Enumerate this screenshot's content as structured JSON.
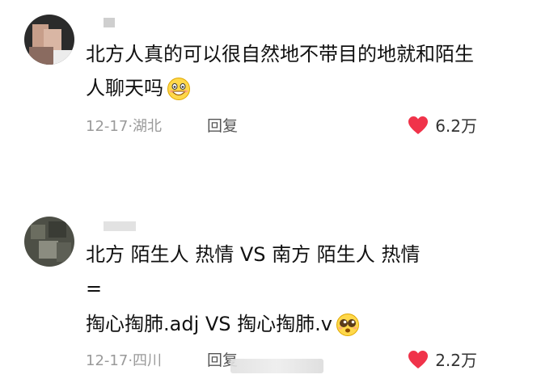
{
  "comments": [
    {
      "lines": [
        "北方人真的可以很自然地不带目的地就和陌生",
        "人聊天吗"
      ],
      "date": "12-17",
      "location": "湖北",
      "reply_label": "回复",
      "likes": "6.2万",
      "emoji": "grinning-face-icon"
    },
    {
      "lines": [
        "北方  陌生人 热情  VS  南方 陌生人 热情",
        "=",
        "掏心掏肺.adj  VS  掏心掏肺.v"
      ],
      "date": "12-17",
      "location": "四川",
      "reply_label": "回复",
      "likes": "2.2万",
      "emoji": "pleading-face-icon"
    }
  ],
  "colors": {
    "heart": "#f0334a",
    "meta": "#9a9a9a"
  }
}
